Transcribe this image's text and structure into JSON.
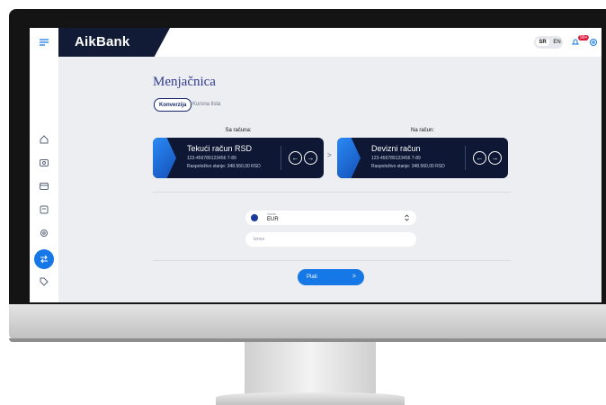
{
  "brand": {
    "logo": "AikBank",
    "accent": "#1677e6",
    "navy": "#111b36"
  },
  "header": {
    "languages": [
      "SR",
      "EN"
    ],
    "active_language": "SR",
    "notification_count": "99+",
    "icons": [
      "bell-icon",
      "gear-icon",
      "logout-icon"
    ]
  },
  "sidebar": {
    "icons": [
      "menu-icon",
      "home-icon",
      "accounts-icon",
      "cards-icon",
      "payments-icon",
      "settings-icon",
      "exchange-icon",
      "tag-icon"
    ],
    "active": "exchange-icon"
  },
  "page": {
    "title": "Menjačnica",
    "tabs": [
      {
        "label": "Konverzija",
        "active": true
      },
      {
        "label": "Kursna lista",
        "active": false
      }
    ]
  },
  "from": {
    "label": "Sa računa:",
    "card": {
      "name": "Tekući račun RSD",
      "number": "123-456789123456 7-89",
      "balance": "Raspoloživo stanje: 348.560,00 RSD"
    }
  },
  "to": {
    "label": "Na račun:",
    "card": {
      "name": "Devizni račun",
      "number": "123-456789123456 7-89",
      "balance": "Raspoloživo stanje: 348.560,00 RSD"
    }
  },
  "currency": {
    "caption": "Valuta",
    "value": "EUR"
  },
  "amount": {
    "placeholder": "Iznos"
  },
  "pay_button": {
    "label": "Plati",
    "arrow": ">"
  },
  "glyphs": {
    "prev": "←",
    "next": "→",
    "chevron": ">",
    "caret": "⌃⌄"
  }
}
